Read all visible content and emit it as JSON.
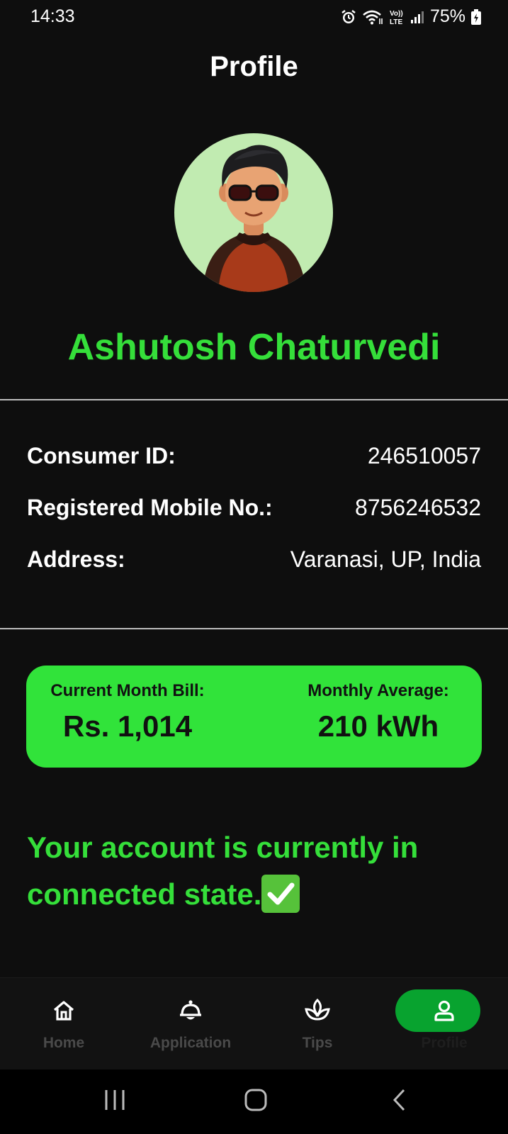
{
  "status_bar": {
    "time": "14:33",
    "battery": "75%",
    "icons": [
      "alarm-icon",
      "wifi-icon",
      "volte-icon",
      "signal-icon",
      "battery-icon"
    ]
  },
  "header": {
    "title": "Profile"
  },
  "profile": {
    "avatar": "avatar-illustration",
    "name": "Ashutosh Chaturvedi"
  },
  "info": [
    {
      "label": "Consumer ID:",
      "value": "246510057"
    },
    {
      "label": "Registered Mobile No.:",
      "value": "8756246532"
    },
    {
      "label": "Address:",
      "value": "Varanasi, UP, India"
    }
  ],
  "bill_card": {
    "current_label": "Current Month Bill:",
    "current_value": "Rs. 1,014",
    "average_label": "Monthly Average:",
    "average_value": "210 kWh"
  },
  "account_status": {
    "message": "Your account is currently in connected state.",
    "icon": "check-mark-icon"
  },
  "bottom_nav": {
    "items": [
      {
        "label": "Home",
        "icon": "home-icon",
        "active": false
      },
      {
        "label": "Application",
        "icon": "bell-icon",
        "active": false
      },
      {
        "label": "Tips",
        "icon": "leaf-icon",
        "active": false
      },
      {
        "label": "Profile",
        "icon": "user-icon",
        "active": true
      }
    ]
  },
  "colors": {
    "background": "#0e0e0e",
    "accent_green": "#35df3a",
    "card_green": "#31e33a",
    "active_pill": "#08a32f"
  }
}
